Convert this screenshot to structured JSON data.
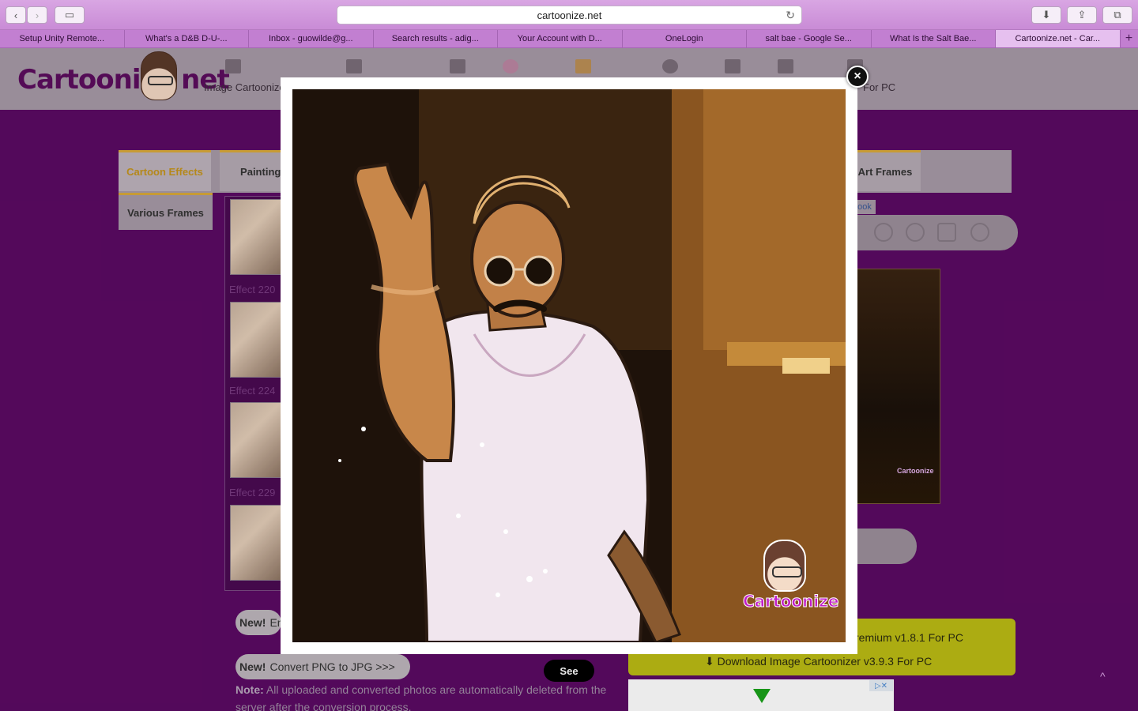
{
  "browser": {
    "address": "cartoonize.net",
    "tabs": [
      {
        "label": "Setup Unity Remote..."
      },
      {
        "label": "What's a D&B D-U-..."
      },
      {
        "label": "Inbox - guowilde@g..."
      },
      {
        "label": "Search results - adig..."
      },
      {
        "label": "Your Account with D..."
      },
      {
        "label": "OneLogin"
      },
      {
        "label": "salt bae - Google Se..."
      },
      {
        "label": "What Is the Salt Bae..."
      },
      {
        "label": "Cartoonize.net - Car..."
      }
    ],
    "new_tab": "+"
  },
  "site": {
    "logo": "Cartoonize net",
    "nav_left_text": "Image Cartoonizer",
    "nav_right_text": "For PC"
  },
  "content": {
    "tabs": [
      "Cartoon Effects",
      "Painting Ef",
      "Art Frames"
    ],
    "tab_row2": "Various Frames",
    "effects": [
      "Effect 220",
      "Effect 224",
      "Effect 229"
    ],
    "fb_chip": "ook",
    "new_pill_1": {
      "badge": "New!",
      "text": "En"
    },
    "new_pill_2": {
      "badge": "New!",
      "text": "Convert PNG to JPG >>>"
    },
    "see_button": "See",
    "note_label": "Note:",
    "note_text": "All uploaded and converted photos are automatically deleted from the server after the conversion process.",
    "download_1": "remium v1.8.1 For PC",
    "download_2": "Download Image Cartoonizer v3.9.3 For PC",
    "preview_badge": "Cartoonize"
  },
  "modal": {
    "close_label": "×",
    "watermark": "Cartoonize"
  }
}
